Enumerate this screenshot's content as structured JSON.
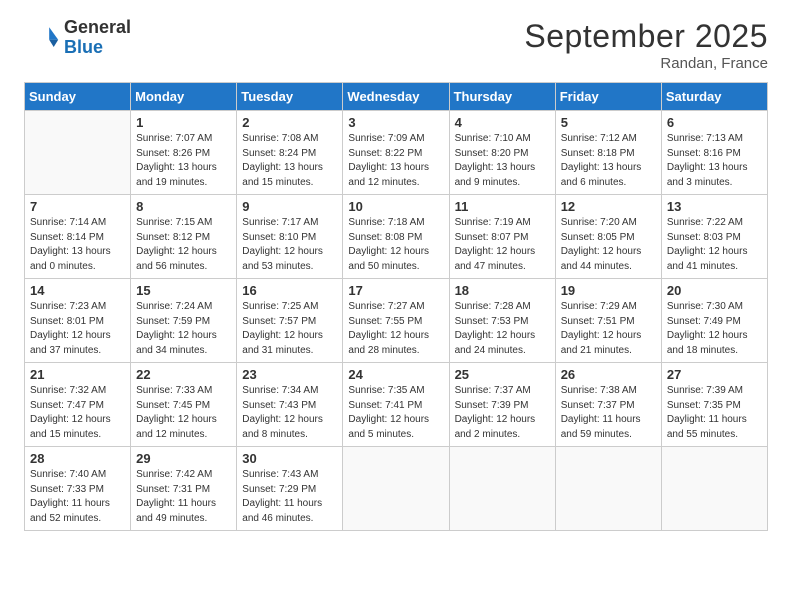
{
  "logo": {
    "general": "General",
    "blue": "Blue"
  },
  "title": "September 2025",
  "subtitle": "Randan, France",
  "days_header": [
    "Sunday",
    "Monday",
    "Tuesday",
    "Wednesday",
    "Thursday",
    "Friday",
    "Saturday"
  ],
  "weeks": [
    [
      {
        "day": "",
        "sunrise": "",
        "sunset": "",
        "daylight": ""
      },
      {
        "day": "1",
        "sunrise": "Sunrise: 7:07 AM",
        "sunset": "Sunset: 8:26 PM",
        "daylight": "Daylight: 13 hours and 19 minutes."
      },
      {
        "day": "2",
        "sunrise": "Sunrise: 7:08 AM",
        "sunset": "Sunset: 8:24 PM",
        "daylight": "Daylight: 13 hours and 15 minutes."
      },
      {
        "day": "3",
        "sunrise": "Sunrise: 7:09 AM",
        "sunset": "Sunset: 8:22 PM",
        "daylight": "Daylight: 13 hours and 12 minutes."
      },
      {
        "day": "4",
        "sunrise": "Sunrise: 7:10 AM",
        "sunset": "Sunset: 8:20 PM",
        "daylight": "Daylight: 13 hours and 9 minutes."
      },
      {
        "day": "5",
        "sunrise": "Sunrise: 7:12 AM",
        "sunset": "Sunset: 8:18 PM",
        "daylight": "Daylight: 13 hours and 6 minutes."
      },
      {
        "day": "6",
        "sunrise": "Sunrise: 7:13 AM",
        "sunset": "Sunset: 8:16 PM",
        "daylight": "Daylight: 13 hours and 3 minutes."
      }
    ],
    [
      {
        "day": "7",
        "sunrise": "Sunrise: 7:14 AM",
        "sunset": "Sunset: 8:14 PM",
        "daylight": "Daylight: 13 hours and 0 minutes."
      },
      {
        "day": "8",
        "sunrise": "Sunrise: 7:15 AM",
        "sunset": "Sunset: 8:12 PM",
        "daylight": "Daylight: 12 hours and 56 minutes."
      },
      {
        "day": "9",
        "sunrise": "Sunrise: 7:17 AM",
        "sunset": "Sunset: 8:10 PM",
        "daylight": "Daylight: 12 hours and 53 minutes."
      },
      {
        "day": "10",
        "sunrise": "Sunrise: 7:18 AM",
        "sunset": "Sunset: 8:08 PM",
        "daylight": "Daylight: 12 hours and 50 minutes."
      },
      {
        "day": "11",
        "sunrise": "Sunrise: 7:19 AM",
        "sunset": "Sunset: 8:07 PM",
        "daylight": "Daylight: 12 hours and 47 minutes."
      },
      {
        "day": "12",
        "sunrise": "Sunrise: 7:20 AM",
        "sunset": "Sunset: 8:05 PM",
        "daylight": "Daylight: 12 hours and 44 minutes."
      },
      {
        "day": "13",
        "sunrise": "Sunrise: 7:22 AM",
        "sunset": "Sunset: 8:03 PM",
        "daylight": "Daylight: 12 hours and 41 minutes."
      }
    ],
    [
      {
        "day": "14",
        "sunrise": "Sunrise: 7:23 AM",
        "sunset": "Sunset: 8:01 PM",
        "daylight": "Daylight: 12 hours and 37 minutes."
      },
      {
        "day": "15",
        "sunrise": "Sunrise: 7:24 AM",
        "sunset": "Sunset: 7:59 PM",
        "daylight": "Daylight: 12 hours and 34 minutes."
      },
      {
        "day": "16",
        "sunrise": "Sunrise: 7:25 AM",
        "sunset": "Sunset: 7:57 PM",
        "daylight": "Daylight: 12 hours and 31 minutes."
      },
      {
        "day": "17",
        "sunrise": "Sunrise: 7:27 AM",
        "sunset": "Sunset: 7:55 PM",
        "daylight": "Daylight: 12 hours and 28 minutes."
      },
      {
        "day": "18",
        "sunrise": "Sunrise: 7:28 AM",
        "sunset": "Sunset: 7:53 PM",
        "daylight": "Daylight: 12 hours and 24 minutes."
      },
      {
        "day": "19",
        "sunrise": "Sunrise: 7:29 AM",
        "sunset": "Sunset: 7:51 PM",
        "daylight": "Daylight: 12 hours and 21 minutes."
      },
      {
        "day": "20",
        "sunrise": "Sunrise: 7:30 AM",
        "sunset": "Sunset: 7:49 PM",
        "daylight": "Daylight: 12 hours and 18 minutes."
      }
    ],
    [
      {
        "day": "21",
        "sunrise": "Sunrise: 7:32 AM",
        "sunset": "Sunset: 7:47 PM",
        "daylight": "Daylight: 12 hours and 15 minutes."
      },
      {
        "day": "22",
        "sunrise": "Sunrise: 7:33 AM",
        "sunset": "Sunset: 7:45 PM",
        "daylight": "Daylight: 12 hours and 12 minutes."
      },
      {
        "day": "23",
        "sunrise": "Sunrise: 7:34 AM",
        "sunset": "Sunset: 7:43 PM",
        "daylight": "Daylight: 12 hours and 8 minutes."
      },
      {
        "day": "24",
        "sunrise": "Sunrise: 7:35 AM",
        "sunset": "Sunset: 7:41 PM",
        "daylight": "Daylight: 12 hours and 5 minutes."
      },
      {
        "day": "25",
        "sunrise": "Sunrise: 7:37 AM",
        "sunset": "Sunset: 7:39 PM",
        "daylight": "Daylight: 12 hours and 2 minutes."
      },
      {
        "day": "26",
        "sunrise": "Sunrise: 7:38 AM",
        "sunset": "Sunset: 7:37 PM",
        "daylight": "Daylight: 11 hours and 59 minutes."
      },
      {
        "day": "27",
        "sunrise": "Sunrise: 7:39 AM",
        "sunset": "Sunset: 7:35 PM",
        "daylight": "Daylight: 11 hours and 55 minutes."
      }
    ],
    [
      {
        "day": "28",
        "sunrise": "Sunrise: 7:40 AM",
        "sunset": "Sunset: 7:33 PM",
        "daylight": "Daylight: 11 hours and 52 minutes."
      },
      {
        "day": "29",
        "sunrise": "Sunrise: 7:42 AM",
        "sunset": "Sunset: 7:31 PM",
        "daylight": "Daylight: 11 hours and 49 minutes."
      },
      {
        "day": "30",
        "sunrise": "Sunrise: 7:43 AM",
        "sunset": "Sunset: 7:29 PM",
        "daylight": "Daylight: 11 hours and 46 minutes."
      },
      {
        "day": "",
        "sunrise": "",
        "sunset": "",
        "daylight": ""
      },
      {
        "day": "",
        "sunrise": "",
        "sunset": "",
        "daylight": ""
      },
      {
        "day": "",
        "sunrise": "",
        "sunset": "",
        "daylight": ""
      },
      {
        "day": "",
        "sunrise": "",
        "sunset": "",
        "daylight": ""
      }
    ]
  ]
}
